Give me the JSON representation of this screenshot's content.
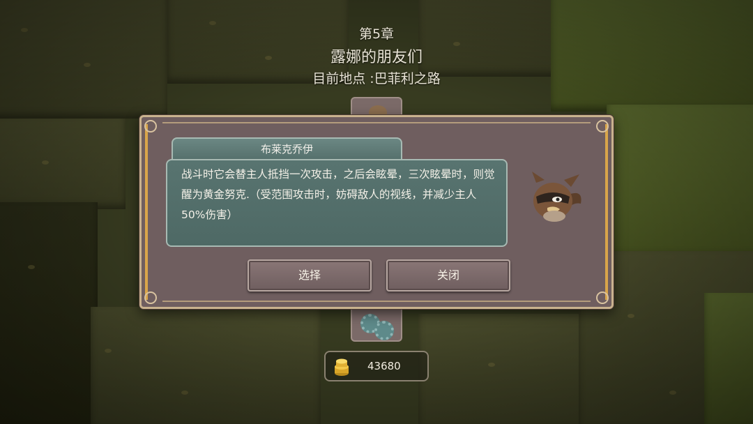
{
  "header": {
    "chapter": "第5章",
    "chapter_title": "露娜的朋友们",
    "location": "目前地点 :巴菲利之路"
  },
  "dialog": {
    "name": "布莱克乔伊",
    "description": "战斗时它会替主人抵挡一次攻击，之后会眩晕，三次眩晕时，则觉醒为黄金努克.（受范围攻击时，妨碍敌人的视线，并减少主人50%伤害）",
    "select_label": "选择",
    "close_label": "关闭",
    "portrait_icon": "sparrow-pet-icon"
  },
  "currency": {
    "icon": "gold-coin-stack-icon",
    "value": "43680"
  },
  "colors": {
    "dialog_bg": "#6f5e5f",
    "panel_teal": "#587470",
    "gold_trim": "#d9a54a",
    "text_light": "#f4f1e8"
  }
}
